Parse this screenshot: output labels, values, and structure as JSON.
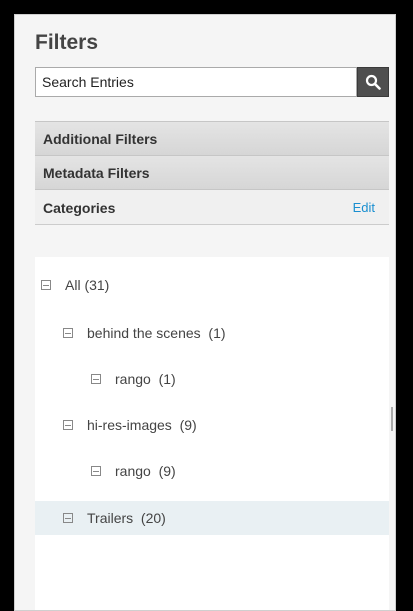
{
  "panel": {
    "title": "Filters"
  },
  "search": {
    "value": "Search Entries"
  },
  "sections": {
    "additional_filters": "Additional Filters",
    "metadata_filters": "Metadata Filters",
    "categories": "Categories",
    "edit": "Edit"
  },
  "tree": [
    {
      "label": "All (31)",
      "level": 0,
      "selected": false
    },
    {
      "label": "behind the scenes  (1)",
      "level": 1,
      "selected": false
    },
    {
      "label": "rango  (1)",
      "level": 2,
      "selected": false
    },
    {
      "label": "hi-res-images  (9)",
      "level": 1,
      "selected": false
    },
    {
      "label": "rango  (9)",
      "level": 2,
      "selected": false
    },
    {
      "label": "Trailers  (20)",
      "level": 1,
      "selected": true
    }
  ],
  "icons": {
    "search": "search-icon",
    "toggle": "collapse-icon"
  },
  "colors": {
    "link": "#1a8fd0",
    "selected_row": "#e9f0f3",
    "search_button": "#4f4f4f"
  }
}
